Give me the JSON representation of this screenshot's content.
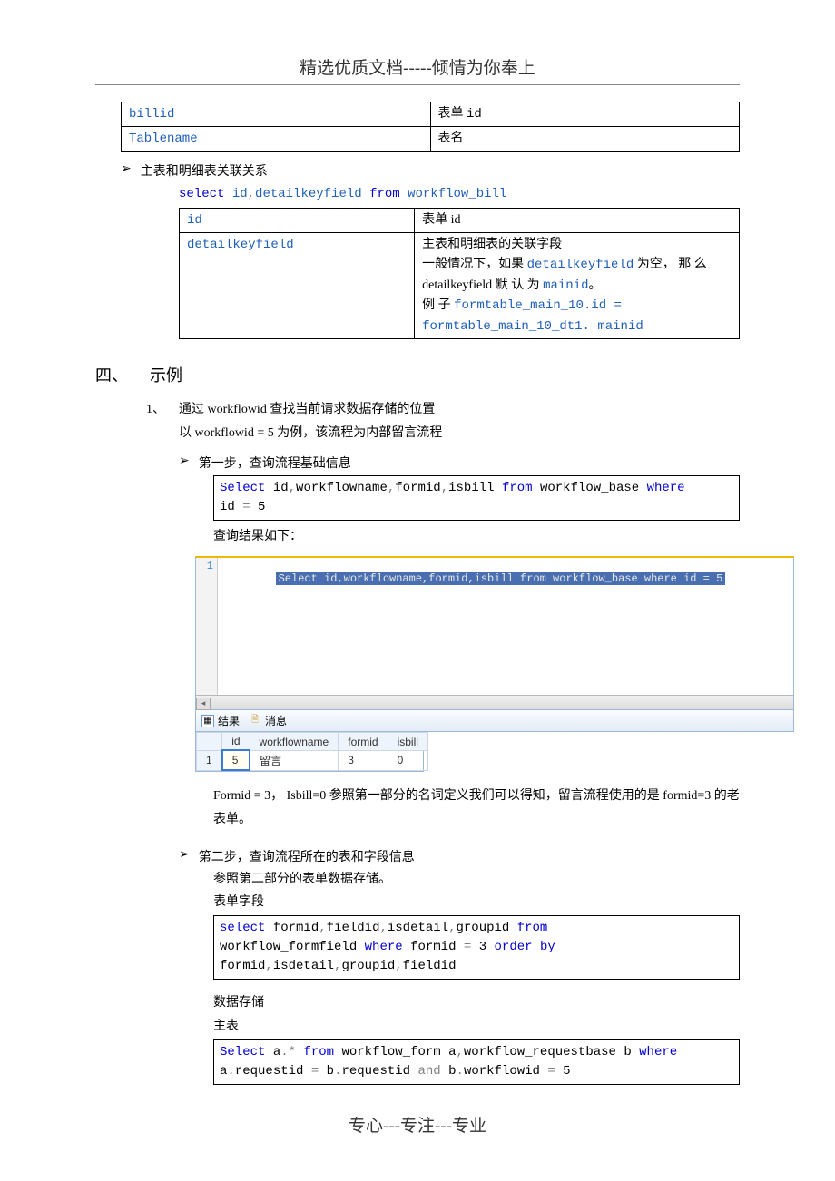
{
  "header": "精选优质文档-----倾情为你奉上",
  "footer": "专心---专注---专业",
  "topTable": {
    "rows": [
      [
        "billid",
        "表单 id"
      ],
      [
        "Tablename",
        "表名"
      ]
    ]
  },
  "relBullet": "主表和明细表关联关系",
  "relSql": "select id,detailkeyfield from workflow_bill",
  "relTable": {
    "r1": [
      "id",
      "表单 id"
    ],
    "r2c1": "detailkeyfield",
    "r2c2a": "主表和明细表的关联字段",
    "r2c2b_pre": "一般情况下，如果 ",
    "r2c2b_code": "detailkeyfield",
    "r2c2b_post": " 为空， 那 么 detailkeyfield 默 认 为 ",
    "r2c2b_code2": "mainid",
    "r2c2b_end": "。",
    "r2c2c_pre": "例 子   ",
    "r2c2c_code": "formtable_main_10.id  = formtable_main_10_dt1. mainid"
  },
  "sec4": {
    "num": "四、",
    "title": "示例"
  },
  "item1": {
    "num": "1、",
    "title": "通过 workflowid 查找当前请求数据存储的位置",
    "line2": "以 workflowid = 5  为例，该流程为内部留言流程",
    "step1": "第一步，查询流程基础信息",
    "sql1": "Select id,workflowname,formid,isbill from workflow_base where id = 5",
    "resLabel": "查询结果如下：",
    "ssCode": "Select id,workflowname,formid,isbill from workflow_base where id = 5",
    "tabs": {
      "res": "结果",
      "msg": "消息"
    },
    "resultCols": [
      "id",
      "workflowname",
      "formid",
      "isbill"
    ],
    "resultRow": [
      "1",
      "5",
      "留言",
      "3",
      "0"
    ],
    "explain": "Formid = 3，   Isbill=0  参照第一部分的名词定义我们可以得知，留言流程使用的是 formid=3 的老表单。",
    "step2": "第二步，查询流程所在的表和字段信息",
    "step2a": "参照第二部分的表单数据存储。",
    "step2b": "表单字段",
    "sql2": "select formid,fieldid,isdetail,groupid from workflow_formfield where formid = 3 order by formid,isdetail,groupid,fieldid",
    "storeLabel": "数据存储",
    "mainLabel": "主表",
    "sql3": "Select a.* from workflow_form a,workflow_requestbase b where a.requestid = b.requestid and b.workflowid = 5"
  }
}
